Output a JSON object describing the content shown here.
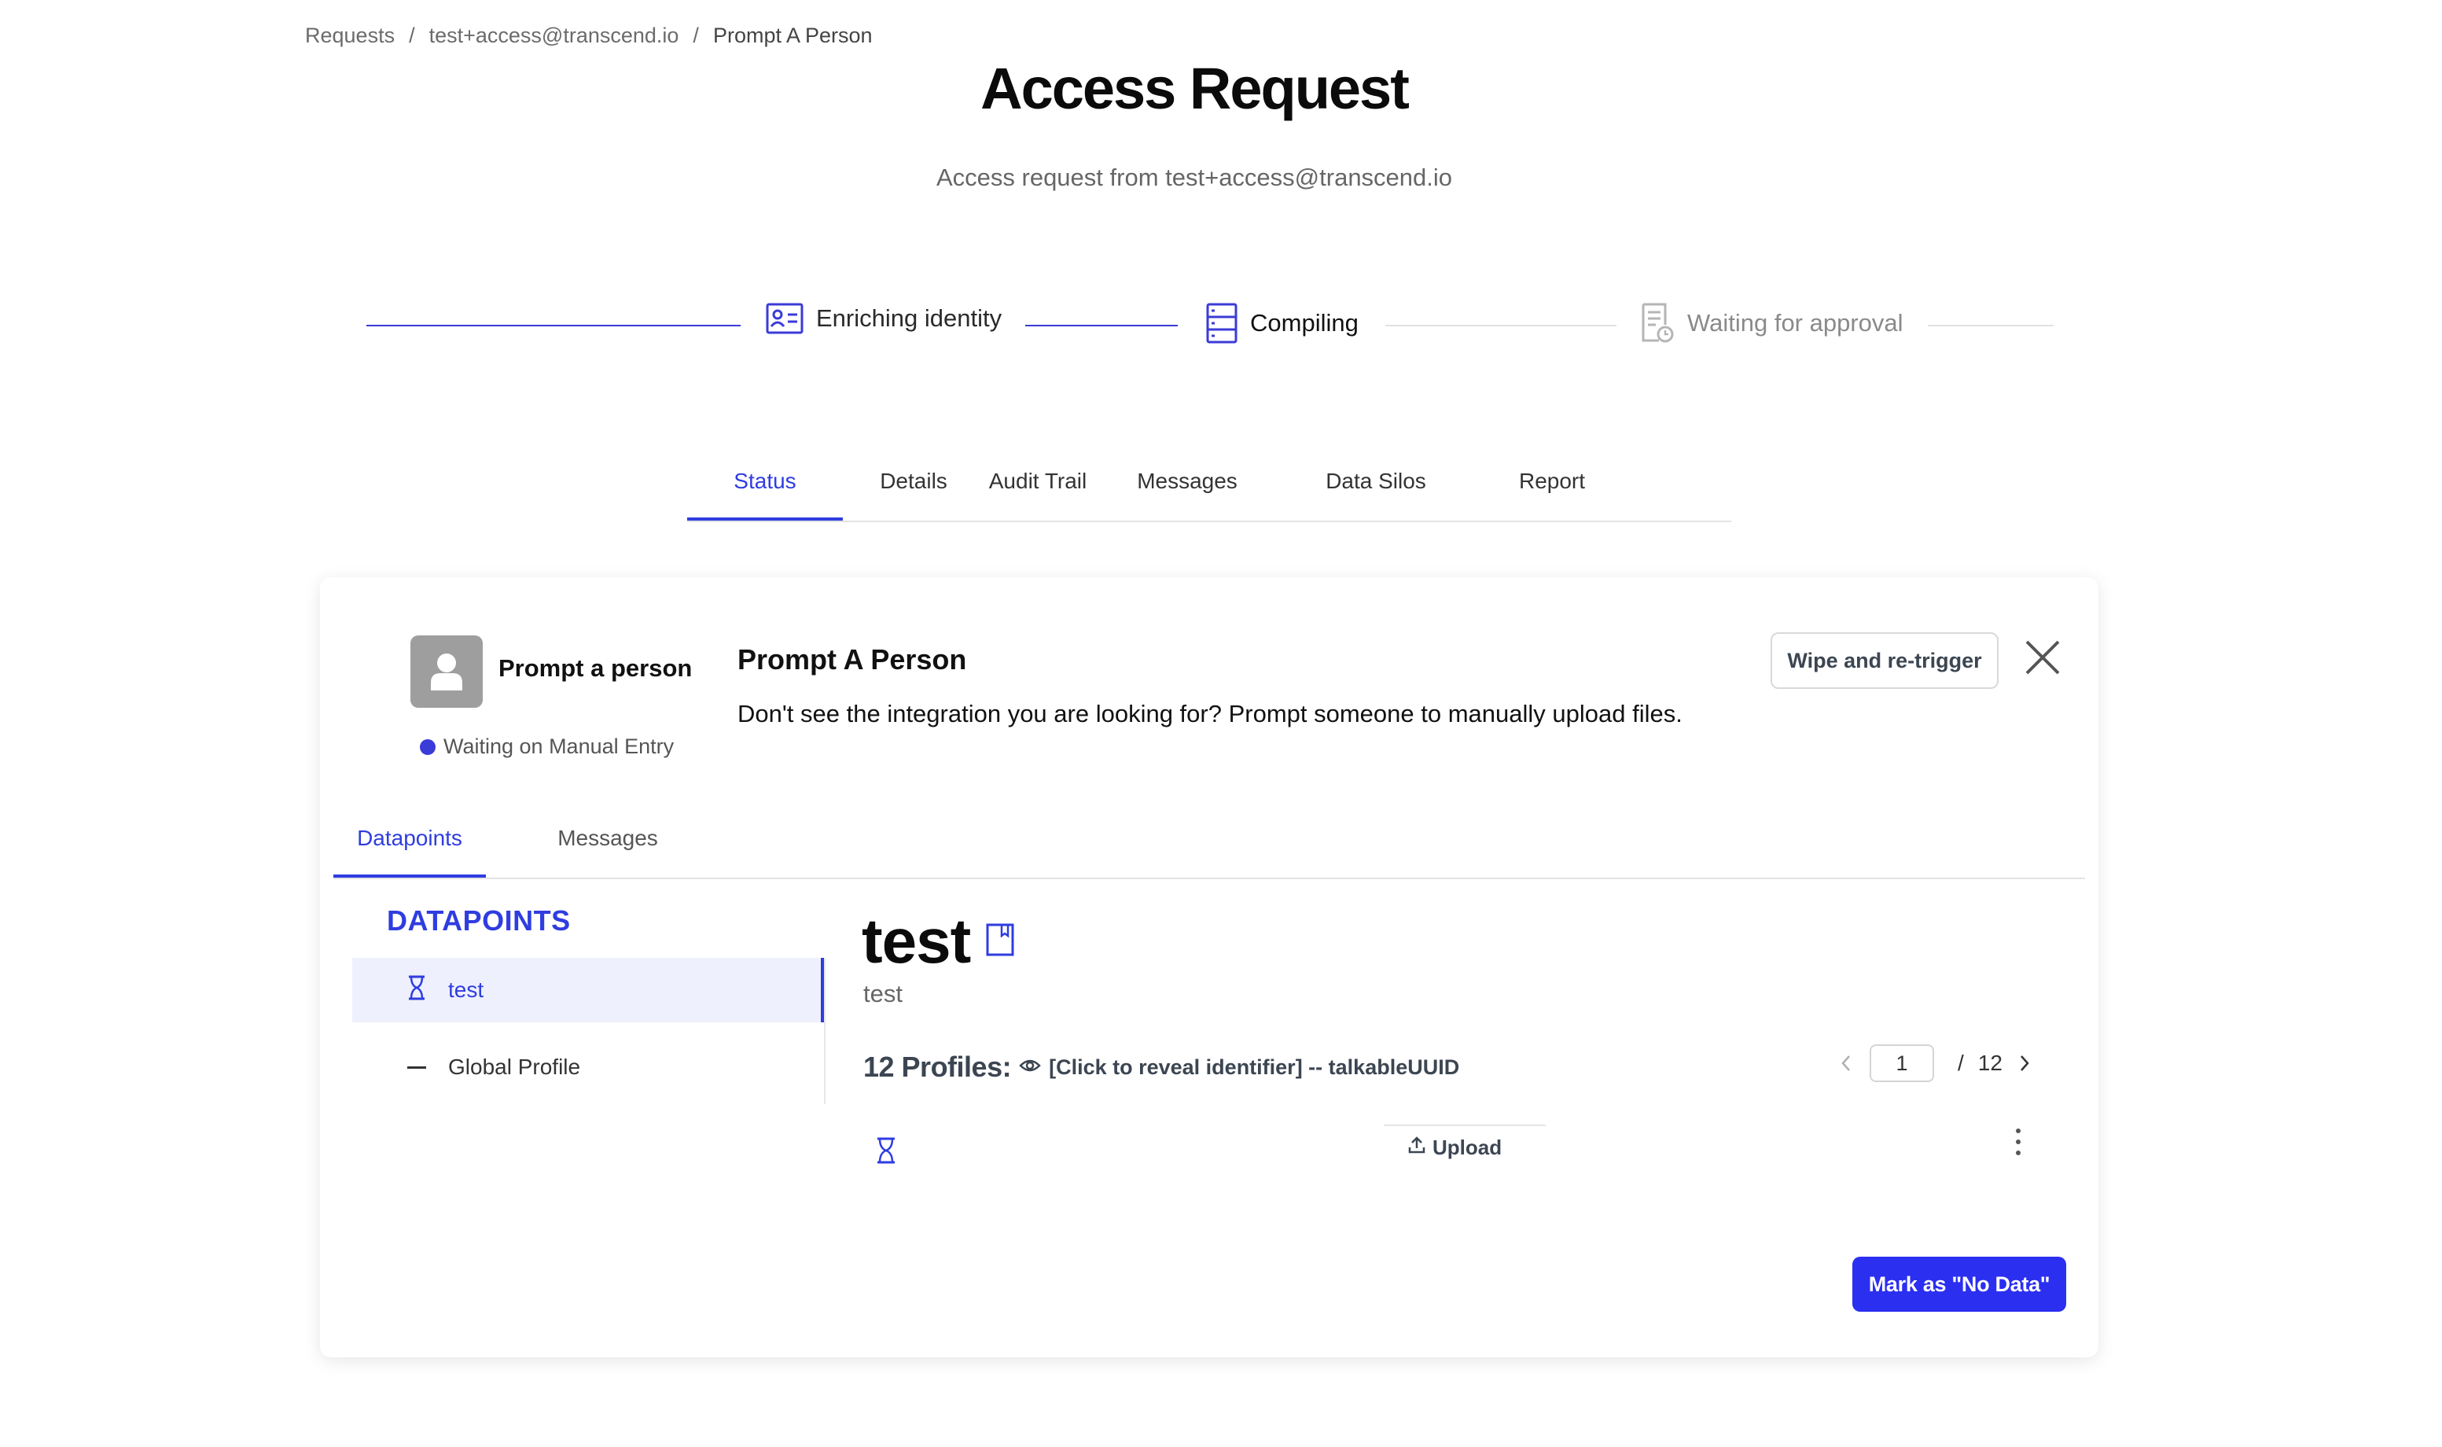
{
  "breadcrumb": {
    "items": [
      "Requests",
      "test+access@transcend.io",
      "Prompt A Person"
    ],
    "separator": "/"
  },
  "header": {
    "title": "Access Request",
    "subtitle": "Access request from test+access@transcend.io"
  },
  "progress": {
    "steps": [
      {
        "label": "Enriching identity",
        "icon": "id-card-icon",
        "state": "complete"
      },
      {
        "label": "Compiling",
        "icon": "server-icon",
        "state": "active"
      },
      {
        "label": "Waiting for approval",
        "icon": "document-clock-icon",
        "state": "pending"
      }
    ]
  },
  "tabs": [
    "Status",
    "Details",
    "Audit Trail",
    "Messages",
    "Data Silos",
    "Report"
  ],
  "active_tab": "Status",
  "card": {
    "integration": {
      "name": "Prompt a person",
      "status": "Waiting on Manual Entry",
      "avatar_icon": "person-icon"
    },
    "title": "Prompt A Person",
    "description": "Don't see the integration you are looking for? Prompt someone to manually upload files.",
    "wipe_button": "Wipe and re-trigger",
    "inner_tabs": [
      "Datapoints",
      "Messages"
    ],
    "datapoints": {
      "heading": "DATAPOINTS",
      "items": [
        {
          "label": "test",
          "icon": "hourglass-icon",
          "selected": true
        },
        {
          "label": "Global Profile",
          "icon": "dash-icon",
          "selected": false
        }
      ]
    },
    "detail": {
      "title": "test",
      "subtitle": "test",
      "profiles_count": "12 Profiles:",
      "reveal_text": "[Click to reveal identifier] -- talkableUUID",
      "page_current": "1",
      "page_total": "12",
      "page_separator": "/",
      "upload_label": "Upload"
    },
    "mark_no_data_button": "Mark as \"No Data\""
  },
  "colors": {
    "accent": "#2f3de0",
    "primary_button": "#2b2ff0",
    "status_dot": "#3b3bd8",
    "avatar_bg": "#9e9e9e"
  }
}
